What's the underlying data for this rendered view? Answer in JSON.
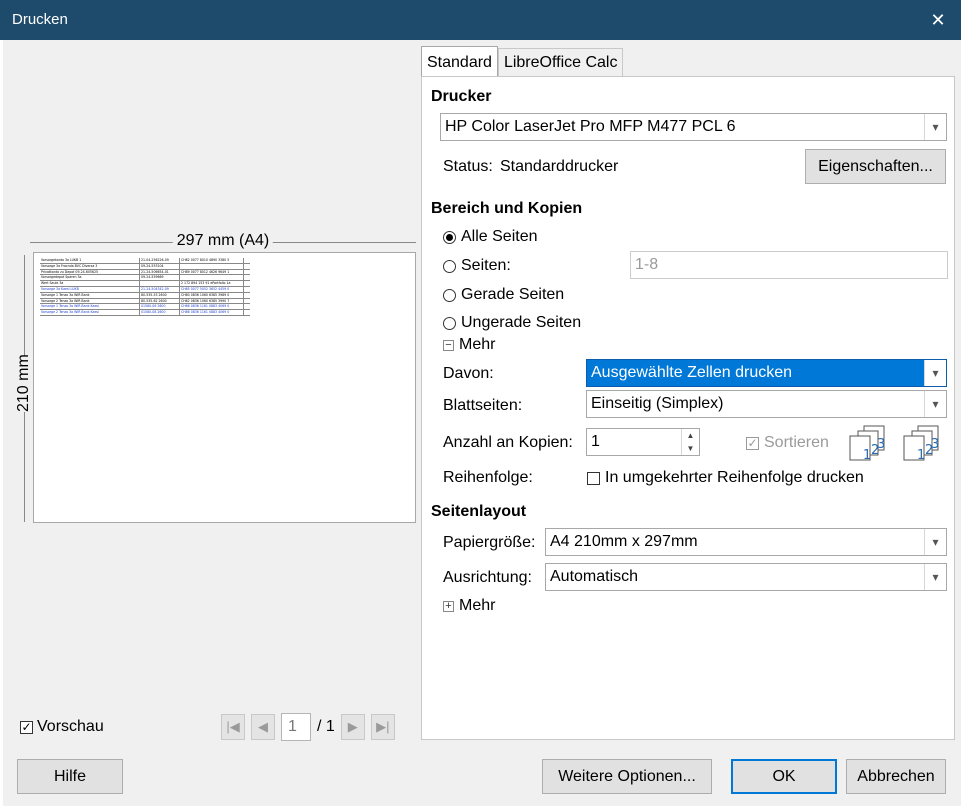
{
  "window": {
    "title": "Drucken",
    "close_label": "✕"
  },
  "preview": {
    "width_label": "297 mm (A4)",
    "height_label": "210 mm",
    "mini_rows": [
      {
        "a": "Vorsorgekonto 3a LUKB 1",
        "b": "21-04-256226-09",
        "c": "CH62 0077 8010 4890 3380 5",
        "blue": false
      },
      {
        "a": "Vorsorge 3a Fracnda BVC Diversa 3",
        "b": "09-24-553104",
        "c": "",
        "blue": false
      },
      {
        "a": "Privatkonto zu Depot 09-24-605625",
        "b": "21-24-506654-01",
        "c": "CH89 0077 8012 4626 9649 1",
        "blue": false
      },
      {
        "a": "Vorsorgedepot Sparen 3a",
        "b": "09-24-559669",
        "c": "",
        "blue": false
      },
      {
        "a": "Wert Saule 3a",
        "b": "",
        "c": "2 172 894 153 91 ePortfolio 1a",
        "blue": false
      },
      {
        "a": "Vorsorge 3a Kaesi LUKB",
        "b": "21-24-504342-09",
        "c": "CH65 0077 5052 3652 4459 0",
        "blue": true
      },
      {
        "a": "Vorsorge 1 Tenzo 3a WIR Bank",
        "b": "80-535-53 2600",
        "c": "CH60 0836 1060 6385 3989 0",
        "blue": false
      },
      {
        "a": "Vorsorge 2 Tenzo 3a WIR Bank",
        "b": "80-535-62 2600",
        "c": "CH62 0836 1060 6385 3990 7",
        "blue": false
      },
      {
        "a": "Vorsorge 1 Tenzo 3a WIR Bank Kaesi",
        "b": "01580-06 2600",
        "c": "CH66 0836 1161 0883 4069 0",
        "blue": true
      },
      {
        "a": "Vorsorge 2 Tenzo 3a WIR Bank Kaesi",
        "b": "01580-08 2600",
        "c": "CH86 0836 1161 0883 4069 0",
        "blue": true
      }
    ],
    "vorschau_label": "Vorschau",
    "page_current": "1",
    "page_total": "/ 1"
  },
  "tabs": [
    "Standard",
    "LibreOffice Calc"
  ],
  "drucker": {
    "heading": "Drucker",
    "printer": "HP Color LaserJet Pro MFP M477 PCL 6",
    "status_label": "Status:",
    "status_value": "Standarddrucker",
    "properties_button": "Eigenschaften..."
  },
  "bereich": {
    "heading": "Bereich und Kopien",
    "options": [
      "Alle Seiten",
      "Seiten:",
      "Gerade Seiten",
      "Ungerade Seiten"
    ],
    "pages_value": "1-8",
    "mehr_label": "Mehr",
    "davon_label": "Davon:",
    "davon_value": "Ausgewählte Zellen drucken",
    "blattseiten_label": "Blattseiten:",
    "blattseiten_value": "Einseitig (Simplex)",
    "kopien_label": "Anzahl an Kopien:",
    "kopien_value": "1",
    "sortieren_label": "Sortieren",
    "reihenfolge_label": "Reihenfolge:",
    "reihenfolge_option": "In umgekehrter Reihenfolge drucken"
  },
  "seitenlayout": {
    "heading": "Seitenlayout",
    "papier_label": "Papiergröße:",
    "papier_value": "A4 210mm x 297mm",
    "ausrichtung_label": "Ausrichtung:",
    "ausrichtung_value": "Automatisch",
    "mehr_label": "Mehr"
  },
  "buttons": {
    "hilfe": "Hilfe",
    "weitere": "Weitere Optionen...",
    "ok": "OK",
    "abbrechen": "Abbrechen"
  }
}
